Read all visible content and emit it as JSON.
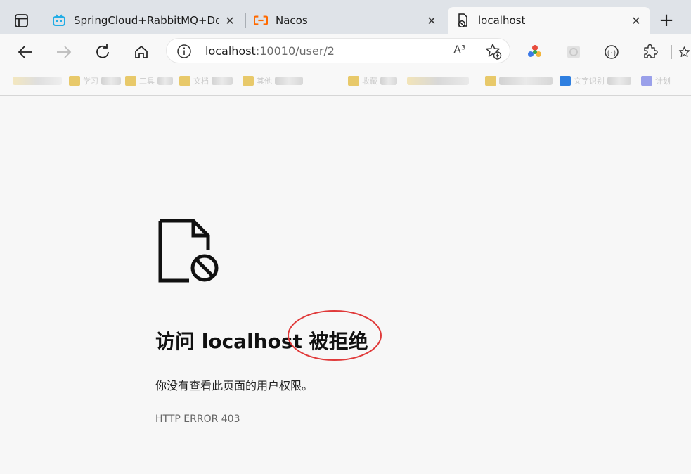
{
  "tabs": [
    {
      "title": "SpringCloud+RabbitMQ+Docke",
      "favicon": "bilibili-icon",
      "color": "#23ade5"
    },
    {
      "title": "Nacos",
      "favicon": "alibaba-cloud-icon",
      "color": "#ff6a00"
    },
    {
      "title": "localhost",
      "favicon": "blocked-page-icon",
      "color": "#1b1b1b"
    }
  ],
  "toolbar": {
    "url_host": "localhost",
    "url_path": ":10010/user/2",
    "read_aloud_label": "A³"
  },
  "favorites": [
    {
      "color": "#e8c96a",
      "label": "学习"
    },
    {
      "color": "#e8c96a",
      "label": "工具"
    },
    {
      "color": "#e8c96a",
      "label": "文档"
    },
    {
      "color": "#e8c96a",
      "label": "其他"
    },
    {
      "color": "#e8c96a",
      "label": "收藏"
    },
    {
      "color": "#2f7fe0",
      "label": "文字识别"
    },
    {
      "color": "#6d76e8",
      "label": "计划"
    }
  ],
  "error": {
    "title": "访问 localhost 被拒绝",
    "description": "你没有查看此页面的用户权限。",
    "code": "HTTP ERROR 403",
    "annotation_color": "#e03a3a"
  }
}
